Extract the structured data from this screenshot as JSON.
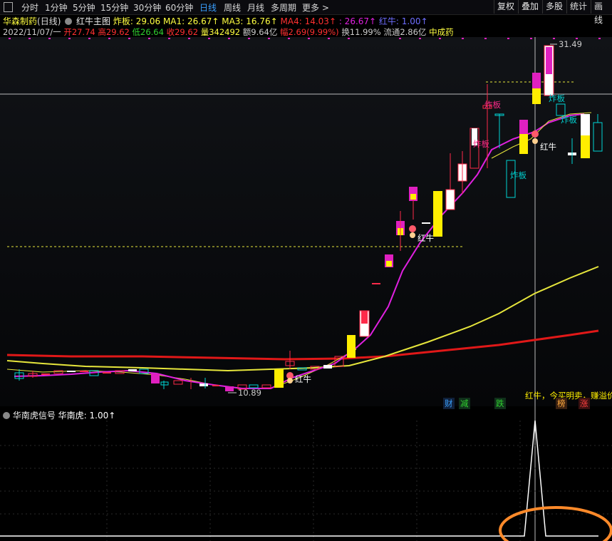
{
  "toolbar": {
    "periods": [
      "分时",
      "1分钟",
      "5分钟",
      "15分钟",
      "30分钟",
      "60分钟",
      "日线",
      "周线",
      "月线",
      "多周期",
      "更多 >"
    ],
    "active_period": "日线",
    "right_buttons": [
      "复权",
      "叠加",
      "多股",
      "统计",
      "画线"
    ]
  },
  "header": {
    "stock_name": "华森制药",
    "period_label": "(日线)",
    "indicator_name": "红牛主图",
    "zhaban": "炸板: 29.06",
    "ma1": "MA1: 26.67↑",
    "ma3": "MA3: 16.76↑",
    "ma4": "MA4: 14.03↑",
    "colon_val": ": 26.67↑",
    "hongniu": "红牛: 1.00↑"
  },
  "quote": {
    "date": "2022/11/07/一",
    "open": "开27.74",
    "high": "高29.62",
    "low": "低26.64",
    "close": "收29.62",
    "volume": "量342492",
    "amount": "额9.64亿",
    "change": "幅2.69(9.99%)",
    "turnover": "换11.99%",
    "float": "流通2.86亿",
    "sector": "中成药"
  },
  "chart_labels": {
    "high_price": "31.49",
    "low_price": "10.89",
    "zhaban_labels": [
      "炸板",
      "炸板",
      "炸板",
      "炸板",
      "炸板"
    ],
    "hongniu_labels": [
      "红牛",
      "红牛",
      "红牛"
    ],
    "scroll_text": "红牛，今买明卖，赚溢价",
    "markers": [
      "财",
      "减",
      "跌",
      "榜",
      "涨"
    ]
  },
  "sub_panel": {
    "indicator_name": "华南虎信号",
    "value": "华南虎: 1.00↑"
  },
  "colors": {
    "up": "#ff2a4a",
    "down": "#00d4d4",
    "ma_red": "#e01818",
    "ma_yellow": "#e6e63c",
    "ma_magenta": "#e020e0",
    "yellow_fill": "#ffee00",
    "magenta_fill": "#e020c0"
  },
  "chart_data": {
    "type": "candlestick",
    "high": 31.49,
    "low": 10.89,
    "signal_peak": 1.0
  }
}
